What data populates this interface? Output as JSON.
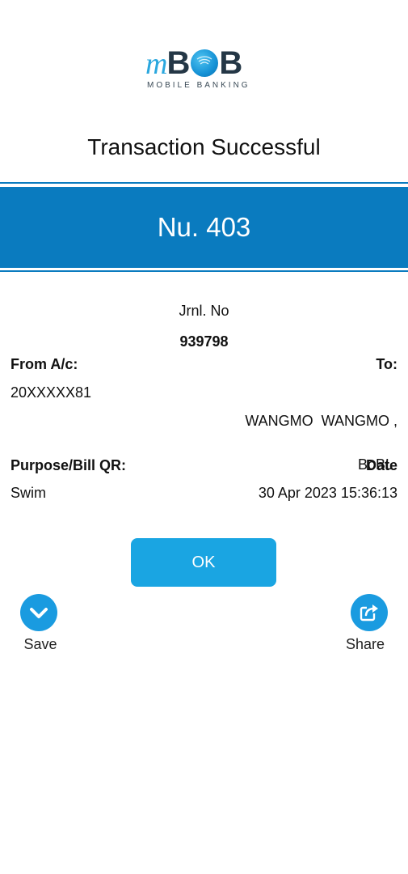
{
  "logo": {
    "brand_prefix": "m",
    "brand_b1": "B",
    "brand_b2": "B",
    "tagline": "MOBILE BANKING"
  },
  "header": {
    "title": "Transaction Successful"
  },
  "amount": {
    "text": "Nu. 403"
  },
  "journal": {
    "label": "Jrnl. No",
    "value": "939798"
  },
  "from": {
    "label": "From A/c:",
    "value": "20XXXXX81"
  },
  "to": {
    "label": "To:",
    "value_line1": "WANGMO  WANGMO ,",
    "value_line2": "BoBL."
  },
  "purpose": {
    "label": "Purpose/Bill QR:",
    "value": "Swim"
  },
  "date": {
    "label": "Date",
    "value": "30 Apr 2023 15:36:13"
  },
  "actions": {
    "ok_label": "OK",
    "save_label": "Save",
    "share_label": "Share"
  },
  "colors": {
    "accent": "#0a7bbf",
    "button": "#1aa5e2",
    "logo_blue": "#2aa7de",
    "logo_dark": "#243746"
  }
}
